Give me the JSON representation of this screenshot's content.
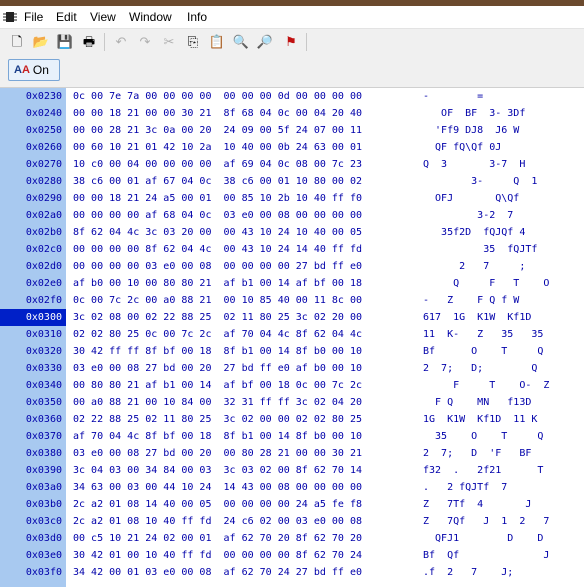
{
  "menubar": {
    "items": [
      "File",
      "Edit",
      "View",
      "Window",
      "Info"
    ]
  },
  "toolbar": {
    "buttons": [
      {
        "icon": "new-document-icon",
        "glyph": "🗋"
      },
      {
        "icon": "open-folder-icon",
        "glyph": "📂"
      },
      {
        "icon": "save-icon",
        "glyph": "💾"
      },
      {
        "icon": "print-icon",
        "glyph": "🖶"
      },
      {
        "icon": "undo-icon",
        "glyph": "↶"
      },
      {
        "icon": "redo-icon",
        "glyph": "↷"
      },
      {
        "icon": "cut-icon",
        "glyph": "✂"
      },
      {
        "icon": "copy-icon",
        "glyph": "⎘"
      },
      {
        "icon": "paste-icon",
        "glyph": "📋"
      },
      {
        "icon": "find-icon",
        "glyph": "🔍"
      },
      {
        "icon": "find-next-icon",
        "glyph": "🔎"
      },
      {
        "icon": "goto-icon",
        "glyph": "⚑"
      }
    ]
  },
  "toggle": {
    "label": "On"
  },
  "hexview": {
    "selected_address": "0x0300",
    "rows": [
      {
        "addr": "0x0230",
        "hex": "0c 00 7e 7a 00 00 00 00  00 00 00 0d 00 00 00 00",
        "ascii": "-        ="
      },
      {
        "addr": "0x0240",
        "hex": "00 00 18 21 00 00 30 21  8f 68 04 0c 00 04 20 40",
        "ascii": "   OF  BF  3- 3Df"
      },
      {
        "addr": "0x0250",
        "hex": "00 00 28 21 3c 0a 00 20  24 09 00 5f 24 07 00 11",
        "ascii": "  'Ff9 DJ8  J6 W"
      },
      {
        "addr": "0x0260",
        "hex": "00 60 10 21 01 42 10 2a  10 40 00 0b 24 63 00 01",
        "ascii": "  QF fQ\\Qf 0J"
      },
      {
        "addr": "0x0270",
        "hex": "10 c0 00 04 00 00 00 00  af 69 04 0c 08 00 7c 23",
        "ascii": "Q  3       3-7  H"
      },
      {
        "addr": "0x0280",
        "hex": "38 c6 00 01 af 67 04 0c  38 c6 00 01 10 80 00 02",
        "ascii": "        3-     Q  1"
      },
      {
        "addr": "0x0290",
        "hex": "00 00 18 21 24 a5 00 01  00 85 10 2b 10 40 ff f0",
        "ascii": "  OFJ       Q\\Qf"
      },
      {
        "addr": "0x02a0",
        "hex": "00 00 00 00 af 68 04 0c  03 e0 00 08 00 00 00 00",
        "ascii": "         3-2  7"
      },
      {
        "addr": "0x02b0",
        "hex": "8f 62 04 4c 3c 03 20 00  00 43 10 24 10 40 00 05",
        "ascii": "   35f2D  fQJQf 4"
      },
      {
        "addr": "0x02c0",
        "hex": "00 00 00 00 8f 62 04 4c  00 43 10 24 14 40 ff fd",
        "ascii": "          35  fQJTf"
      },
      {
        "addr": "0x02d0",
        "hex": "00 00 00 00 03 e0 00 08  00 00 00 00 27 bd ff e0",
        "ascii": "      2   7     ;"
      },
      {
        "addr": "0x02e0",
        "hex": "af b0 00 10 00 80 80 21  af b1 00 14 af bf 00 18",
        "ascii": "     Q     F   T    O"
      },
      {
        "addr": "0x02f0",
        "hex": "0c 00 7c 2c 00 a0 88 21  00 10 85 40 00 11 8c 00",
        "ascii": "-   Z    F Q f W"
      },
      {
        "addr": "0x0300",
        "hex": "3c 02 08 00 02 22 88 25  02 11 80 25 3c 02 20 00",
        "ascii": "617  1G  K1W  Kf1D"
      },
      {
        "addr": "0x0310",
        "hex": "02 02 80 25 0c 00 7c 2c  af 70 04 4c 8f 62 04 4c",
        "ascii": "11  K-   Z   35   35"
      },
      {
        "addr": "0x0320",
        "hex": "30 42 ff ff 8f bf 00 18  8f b1 00 14 8f b0 00 10",
        "ascii": "Bf      O    T     Q"
      },
      {
        "addr": "0x0330",
        "hex": "03 e0 00 08 27 bd 00 20  27 bd ff e0 af b0 00 10",
        "ascii": "2  7;   D;        Q"
      },
      {
        "addr": "0x0340",
        "hex": "00 80 80 21 af b1 00 14  af bf 00 18 0c 00 7c 2c",
        "ascii": "     F     T    O-  Z"
      },
      {
        "addr": "0x0350",
        "hex": "00 a0 88 21 00 10 84 00  32 31 ff ff 3c 02 04 20",
        "ascii": "  F Q    MN   f13D"
      },
      {
        "addr": "0x0360",
        "hex": "02 22 88 25 02 11 80 25  3c 02 00 00 02 02 80 25",
        "ascii": "1G  K1W  Kf1D  11 K"
      },
      {
        "addr": "0x0370",
        "hex": "af 70 04 4c 8f bf 00 18  8f b1 00 14 8f b0 00 10",
        "ascii": "  35    O    T     Q"
      },
      {
        "addr": "0x0380",
        "hex": "03 e0 00 08 27 bd 00 20  00 80 28 21 00 00 30 21",
        "ascii": "2  7;   D  'F   BF"
      },
      {
        "addr": "0x0390",
        "hex": "3c 04 03 00 34 84 00 03  3c 03 02 00 8f 62 70 14",
        "ascii": "f32  .   2f21      T"
      },
      {
        "addr": "0x03a0",
        "hex": "34 63 00 03 00 44 10 24  14 43 00 08 00 00 00 00",
        "ascii": ".   2 fQJTf  7"
      },
      {
        "addr": "0x03b0",
        "hex": "2c a2 01 08 14 40 00 05  00 00 00 00 24 a5 fe f8",
        "ascii": "Z   7Tf  4       J"
      },
      {
        "addr": "0x03c0",
        "hex": "2c a2 01 08 10 40 ff fd  24 c6 02 00 03 e0 00 08",
        "ascii": "Z   7Qf   J  1  2   7"
      },
      {
        "addr": "0x03d0",
        "hex": "00 c5 10 21 24 02 00 01  af 62 70 20 8f 62 70 20",
        "ascii": "  QFJ1        D    D"
      },
      {
        "addr": "0x03e0",
        "hex": "30 42 01 00 10 40 ff fd  00 00 00 00 8f 62 70 24",
        "ascii": "Bf  Qf              J"
      },
      {
        "addr": "0x03f0",
        "hex": "34 42 00 01 03 e0 00 08  af 62 70 24 27 bd ff e0",
        "ascii": ".f  2   7    J;"
      }
    ]
  }
}
